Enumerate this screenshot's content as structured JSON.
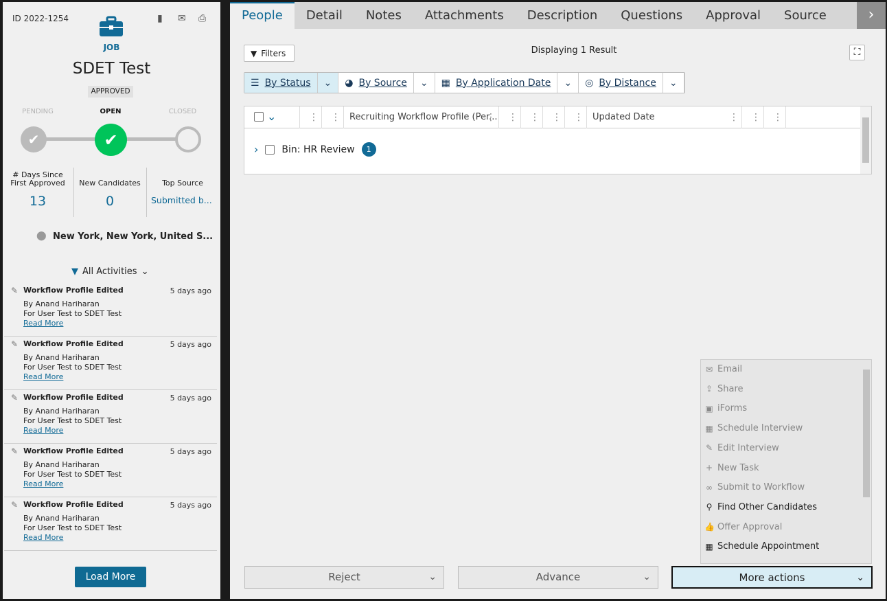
{
  "job": {
    "id": "ID 2022-1254",
    "type_label": "JOB",
    "title": "SDET Test",
    "status_badge": "APPROVED",
    "steps": [
      {
        "label": "PENDING",
        "state": "done"
      },
      {
        "label": "OPEN",
        "state": "current"
      },
      {
        "label": "CLOSED",
        "state": "todo"
      }
    ],
    "stats": [
      {
        "label": "# Days Since\nFirst Approved",
        "value": "13"
      },
      {
        "label": "New Candidates",
        "value": "0"
      },
      {
        "label": "Top Source",
        "value": "Submitted b..."
      }
    ],
    "location": "New York, New York, United S...",
    "header_icons": [
      "copy-icon",
      "share-icon",
      "print-icon"
    ]
  },
  "activities": {
    "filter_label": "All Activities",
    "items": [
      {
        "title": "Workflow Profile Edited",
        "time": "5 days ago",
        "by": "By Anand Hariharan",
        "detail": "For User Test to SDET Test",
        "link": "Read More"
      },
      {
        "title": "Workflow Profile Edited",
        "time": "5 days ago",
        "by": "By Anand Hariharan",
        "detail": "For User Test to SDET Test",
        "link": "Read More"
      },
      {
        "title": "Workflow Profile Edited",
        "time": "5 days ago",
        "by": "By Anand Hariharan",
        "detail": "For User Test to SDET Test",
        "link": "Read More"
      },
      {
        "title": "Workflow Profile Edited",
        "time": "5 days ago",
        "by": "By Anand Hariharan",
        "detail": "For User Test to SDET Test",
        "link": "Read More"
      },
      {
        "title": "Workflow Profile Edited",
        "time": "5 days ago",
        "by": "By Anand Hariharan",
        "detail": "For User Test to SDET Test",
        "link": "Read More"
      }
    ],
    "load_more": "Load More"
  },
  "tabs": [
    "People",
    "Detail",
    "Notes",
    "Attachments",
    "Description",
    "Questions",
    "Approval",
    "Source"
  ],
  "active_tab": "People",
  "toolbar": {
    "filters": "Filters",
    "result_text": "Displaying 1 Result"
  },
  "groupings": [
    {
      "label": "By Status",
      "icon": "list-icon",
      "selected": true
    },
    {
      "label": "By Source",
      "icon": "pie-chart-icon"
    },
    {
      "label": "By Application Date",
      "icon": "calendar-grid-icon"
    },
    {
      "label": "By Distance",
      "icon": "target-icon"
    }
  ],
  "grid": {
    "columns": [
      "",
      "",
      "",
      "Recruiting Workflow Profile (Per...",
      "",
      "",
      "",
      "",
      "Updated Date",
      "",
      ""
    ],
    "bin": {
      "label": "Bin: HR Review",
      "count": "1"
    }
  },
  "actions": {
    "reject": "Reject",
    "advance": "Advance",
    "more": "More actions",
    "menu": [
      {
        "label": "Email",
        "icon": "envelope-icon",
        "enabled": false
      },
      {
        "label": "Share",
        "icon": "share-icon",
        "enabled": false
      },
      {
        "label": "iForms",
        "icon": "form-icon",
        "enabled": false
      },
      {
        "label": "Schedule Interview",
        "icon": "calendar-icon",
        "enabled": false
      },
      {
        "label": "Edit Interview",
        "icon": "pencil-icon",
        "enabled": false
      },
      {
        "label": "New Task",
        "icon": "plus-icon",
        "enabled": false
      },
      {
        "label": "Submit to Workflow",
        "icon": "link-icon",
        "enabled": false
      },
      {
        "label": "Find Other Candidates",
        "icon": "search-icon",
        "enabled": true
      },
      {
        "label": "Offer Approval",
        "icon": "thumbs-up-icon",
        "enabled": false
      },
      {
        "label": "Schedule Appointment",
        "icon": "calendar-icon",
        "enabled": true
      }
    ]
  },
  "colors": {
    "accent": "#116a96",
    "success": "#00c45a"
  }
}
